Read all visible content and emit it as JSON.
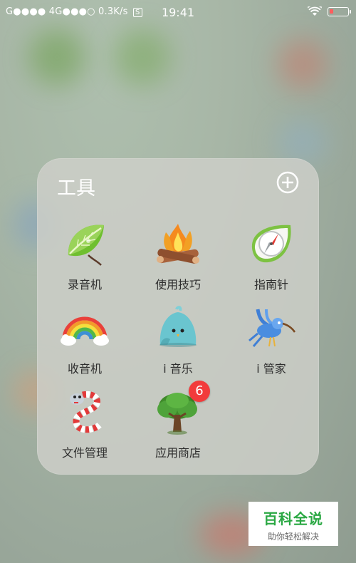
{
  "status_bar": {
    "carrier_text": "G●●●● 4G●●●○ 0.3K/s",
    "sim_icon": "S",
    "time": "19:41",
    "wifi_icon": "wifi-icon",
    "battery_icon": "battery-icon",
    "battery_level": 0.2
  },
  "folder": {
    "title": "工具",
    "add_icon": "plus-circle-icon",
    "apps": [
      {
        "label": "录音机",
        "icon": "leaf-icon"
      },
      {
        "label": "使用技巧",
        "icon": "campfire-icon"
      },
      {
        "label": "指南针",
        "icon": "compass-icon"
      },
      {
        "label": "收音机",
        "icon": "rainbow-icon"
      },
      {
        "label": "i 音乐",
        "icon": "blue-bird-icon"
      },
      {
        "label": "i 管家",
        "icon": "flying-bird-icon"
      },
      {
        "label": "文件管理",
        "icon": "snake-icon"
      },
      {
        "label": "应用商店",
        "icon": "tree-icon",
        "badge": "6"
      }
    ]
  },
  "watermark": {
    "title": "百科全说",
    "subtitle": "助你轻松解决"
  },
  "colors": {
    "badge": "#f23b3b",
    "watermark_green": "#2aa843",
    "folder_bg": "#ced0c9"
  }
}
